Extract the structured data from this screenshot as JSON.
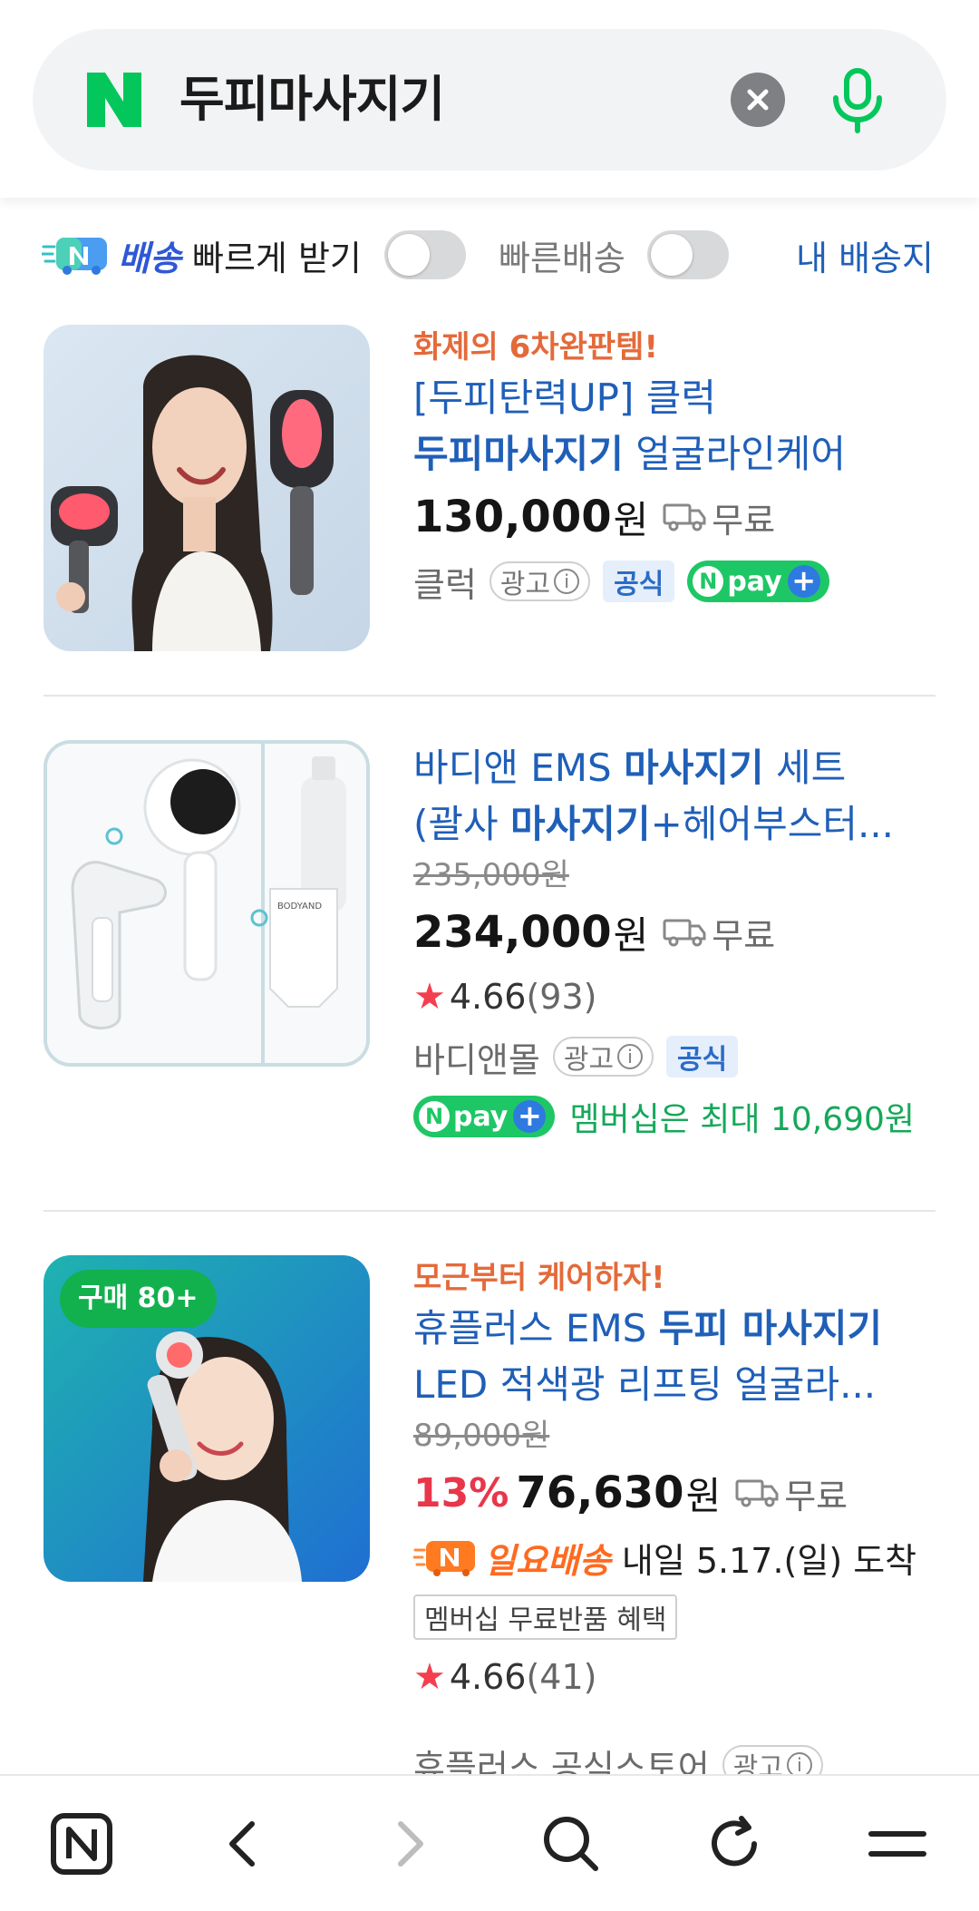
{
  "search": {
    "query": "두피마사지기",
    "clear_icon": "close-icon",
    "mic_icon": "mic-icon"
  },
  "filters": {
    "delivery_badge": "N",
    "delivery_label": "배송",
    "fast_receive": "빠르게 받기",
    "fast_delivery": "빠른배송",
    "my_address": "내 배송지"
  },
  "products": [
    {
      "promo": "화제의 6차완판템!",
      "title_a": "[두피탄력UP] 클럭 ",
      "title_b": "두피마사지기",
      "title_c": " 얼굴라인케어",
      "price": "130,000",
      "currency": "원",
      "shipping": "무료",
      "seller": "클럭",
      "ad": "광고",
      "official": "공식",
      "npay": "pay"
    },
    {
      "title_a": "바디앤 EMS ",
      "title_b": "마사지기",
      "title_c": " 세트",
      "title2_a": "(괄사 ",
      "title2_b": "마사지기",
      "title2_c": "+헤어부스터...",
      "original_price": "235,000원",
      "price": "234,000",
      "currency": "원",
      "shipping": "무료",
      "rating": "4.66",
      "reviews": "(93)",
      "seller": "바디앤몰",
      "ad": "광고",
      "official": "공식",
      "npay": "pay",
      "membership": "멤버십은 최대 10,690원"
    },
    {
      "badge": "구매 80+",
      "promo": "모근부터 케어하자!",
      "title_a": "휴플러스 EMS ",
      "title_b": "두피 마사지기",
      "title2": "LED 적색광 리프팅 얼굴라...",
      "original_price": "89,000원",
      "discount": "13%",
      "price": "76,630",
      "currency": "원",
      "shipping": "무료",
      "sunday_label": "일요배송",
      "sunday_text": "내일 5.17.(일) 도착",
      "benefit": "멤버십 무료반품 혜택",
      "rating": "4.66",
      "reviews": "(41)",
      "seller": "휴플러스 공식스토어",
      "ad": "광고"
    }
  ],
  "bottom_nav": [
    "naver-home-icon",
    "back-icon",
    "forward-icon",
    "search-icon",
    "refresh-icon",
    "menu-icon"
  ],
  "colors": {
    "naver_green": "#03c75a",
    "link_blue": "#1f5fb8",
    "promo_orange": "#e46a3a",
    "discount_red": "#e8364a"
  }
}
